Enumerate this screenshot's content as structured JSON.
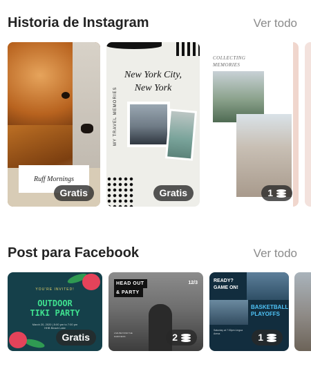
{
  "sections": {
    "instagram": {
      "title": "Historia de Instagram",
      "see_all": "Ver todo",
      "cards": [
        {
          "label": "Ruff Mornings",
          "badge": "Gratis"
        },
        {
          "title_line1": "New York City,",
          "title_line2": "New York",
          "side_text": "MY TRAVEL MEMORIES",
          "badge": "Gratis"
        },
        {
          "caption_line1": "COLLECTING",
          "caption_line2": "MEMORIES",
          "badge": "1"
        }
      ]
    },
    "facebook": {
      "title": "Post para Facebook",
      "see_all": "Ver todo",
      "cards": [
        {
          "eyebrow": "YOU'RE INVITED!",
          "title_line1": "OUTDOOR",
          "title_line2": "TIKI PARTY",
          "details": "March 20, 2020 | 5:00 pm to 7:00 pm",
          "details2": "HHB Beach Lake",
          "badge": "Gratis"
        },
        {
          "tag1": "HEAD OUT",
          "tag2": "& PARTY",
          "page": "12/3",
          "small": "LIVE BEYOND THE DARKNESS",
          "badge": "2"
        },
        {
          "q1": "READY?",
          "q2": "GAME ON!",
          "t1": "BASKETBALL",
          "t2": "PLAYOFFS",
          "info": "Saturday at 7:30pm Lingua Arena",
          "badge": "1"
        },
        {}
      ]
    }
  }
}
